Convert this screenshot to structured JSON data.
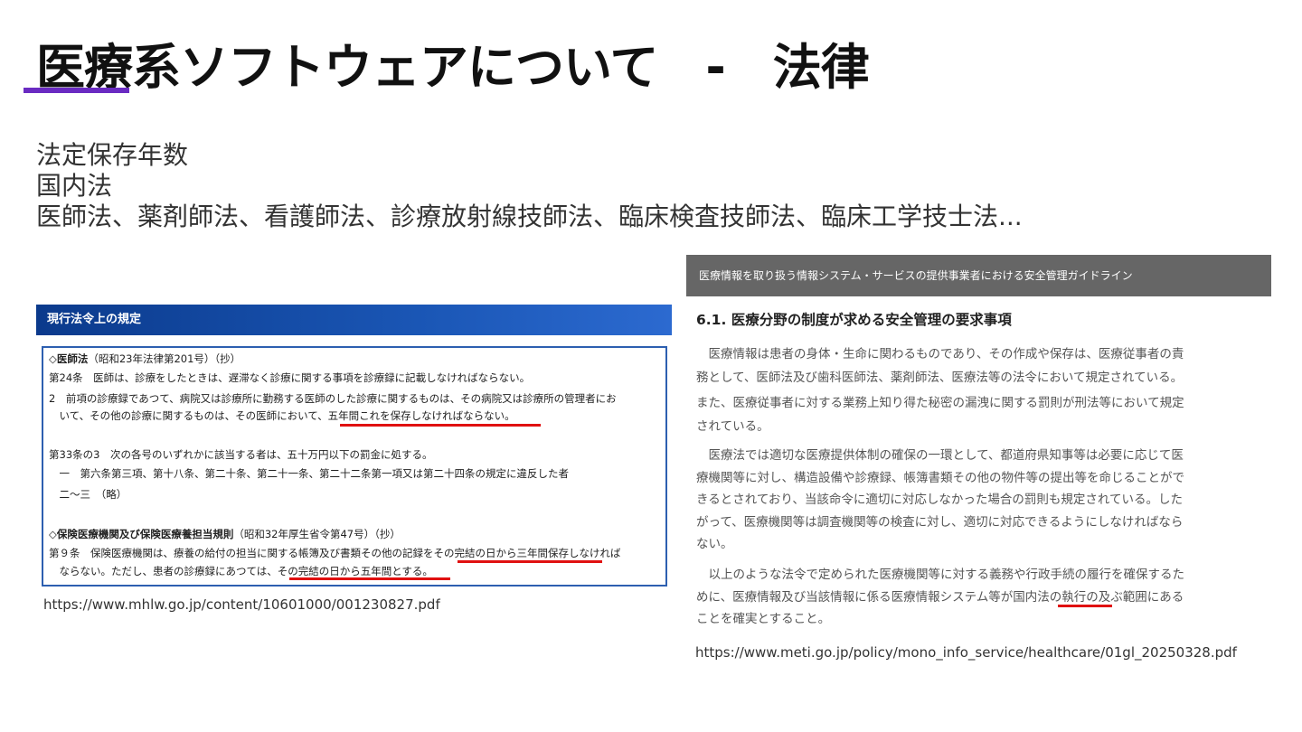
{
  "slide": {
    "title": "医療系ソフトウェアについて　-　法律",
    "accent_color": "#6a2bc2",
    "subtitle_lines": [
      "法定保存年数",
      "国内法",
      "医師法、薬剤師法、看護師法、診療放射線技師法、臨床検査技師法、臨床工学技士法..."
    ]
  },
  "left_excerpt": {
    "header": "現行法令上の規定",
    "lines": [
      {
        "bold": "◇医師法",
        "text": "（昭和23年法律第201号）（抄）"
      },
      {
        "text": "第24条　医師は、診療をしたときは、遅滞なく診療に関する事項を診療録に記載しなければならない。"
      },
      {
        "text": "2　前項の診療録であつて、病院又は診療所に勤務する医師のした診療に関するものは、その病院又は診療所の管理者にお"
      },
      {
        "text": "　いて、その他の診療に関するものは、その医師において、五年間これを保存しなければならない。"
      },
      {
        "text": "第33条の3　次の各号のいずれかに該当する者は、五十万円以下の罰金に処する。"
      },
      {
        "text": "　一　第六条第三項、第十八条、第二十条、第二十一条、第二十二条第一項又は第二十四条の規定に違反した者"
      },
      {
        "text": "　二〜三　（略）"
      },
      {
        "bold": "◇保険医療機関及び保険医療養担当規則",
        "text": "（昭和32年厚生省令第47号）（抄）"
      },
      {
        "text": "第９条　保険医療機関は、療養の給付の担当に関する帳簿及び書類その他の記録をその完結の日から三年間保存しなければ"
      },
      {
        "text": "　ならない。ただし、患者の診療録にあつては、その完結の日から五年間とする。"
      }
    ],
    "url": "https://www.mhlw.go.jp/content/10601000/001230827.pdf"
  },
  "right_excerpt": {
    "header": "医療情報を取り扱う情報システム・サービスの提供事業者における安全管理ガイドライン",
    "section_title": "6.1.  医療分野の制度が求める安全管理の要求事項",
    "lines": [
      "　医療情報は患者の身体・生命に関わるものであり、その作成や保存は、医療従事者の責",
      "務として、医師法及び歯科医師法、薬剤師法、医療法等の法令において規定されている。",
      "また、医療従事者に対する業務上知り得た秘密の漏洩に関する罰則が刑法等において規定",
      "されている。",
      "　医療法では適切な医療提供体制の確保の一環として、都道府県知事等は必要に応じて医",
      "療機関等に対し、構造設備や診療録、帳簿書類その他の物件等の提出等を命じることがで",
      "きるとされており、当該命令に適切に対応しなかった場合の罰則も規定されている。した",
      "がって、医療機関等は調査機関等の検査に対し、適切に対応できるようにしなければなら",
      "ない。",
      "　以上のような法令で定められた医療機関等に対する義務や行政手続の履行を確保するた",
      "めに、医療情報及び当該情報に係る医療情報システム等が国内法の執行の及ぶ範囲にある",
      "ことを確実とすること。"
    ],
    "url": "https://www.meti.go.jp/policy/mono_info_service/healthcare/01gl_20250328.pdf"
  },
  "colors": {
    "highlight_underline": "#e01010",
    "left_header_bg": "#1a56b5",
    "right_header_bg": "#666666"
  }
}
